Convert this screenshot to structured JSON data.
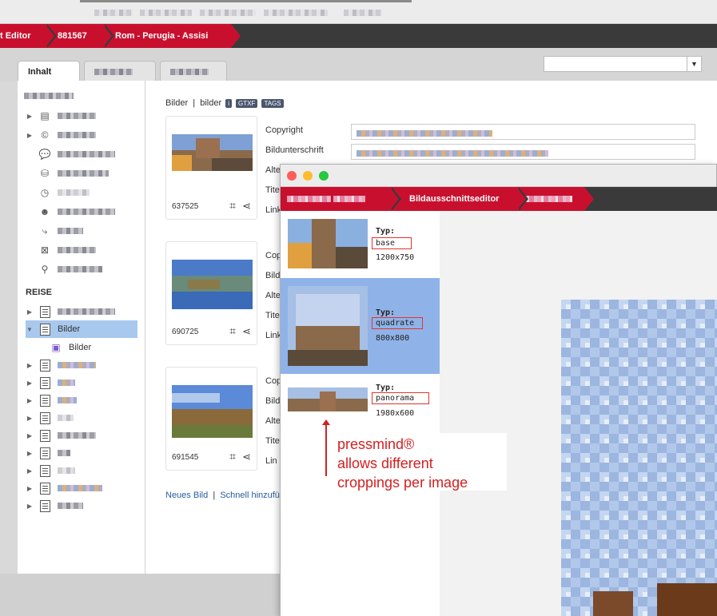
{
  "breadcrumb": {
    "items": [
      "t Editor",
      "881567",
      "Rom - Perugia - Assisi"
    ]
  },
  "tabs": [
    {
      "label": "Inhalt",
      "active": true
    },
    {
      "label": "",
      "active": false
    },
    {
      "label": "",
      "active": false
    }
  ],
  "sidebar": {
    "section_reise": "REISE",
    "selected_label": "Bilder",
    "child_label": "Bilder"
  },
  "main": {
    "bilder_label": "Bilder",
    "bilder_sep": "|",
    "bilder_sub": "bilder",
    "tags": [
      "i",
      "GTXF",
      "TAGS"
    ],
    "fields": {
      "copyright": "Copyright",
      "bildunterschrift": "Bildunterschrift",
      "alt_abbrev": "Alte",
      "titel_abbrev": "Tite",
      "link_abbrev": "Link",
      "cop_abbrev": "Cop",
      "bild_abbrev": "Bild",
      "alt2_abbrev": "Alte",
      "tite2_abbrev": "Tite",
      "lin_abbrev": "Lin"
    },
    "images": [
      {
        "id": "637525"
      },
      {
        "id": "690725"
      },
      {
        "id": "691545"
      }
    ],
    "links": {
      "new_image": "Neues Bild",
      "sep": "|",
      "quick_add": "Schnell hinzufü"
    }
  },
  "popup": {
    "title": "Bildausschnittseditor",
    "crops": [
      {
        "typ_label": "Typ:",
        "type": "base",
        "size": "1200x750",
        "active": false
      },
      {
        "typ_label": "Typ:",
        "type": "quadrate",
        "size": "800x800",
        "active": true
      },
      {
        "typ_label": "Typ:",
        "type": "panorama",
        "size": "1980x600",
        "active": false
      }
    ]
  },
  "annotation": {
    "line1": "pressmind®",
    "line2": "allows different",
    "line3": "croppings per image"
  },
  "colors": {
    "brand_red": "#c8102e",
    "dark_bar": "#3a3a3a",
    "selection_blue": "#a8c8ee",
    "annotation_red": "#d42020"
  }
}
